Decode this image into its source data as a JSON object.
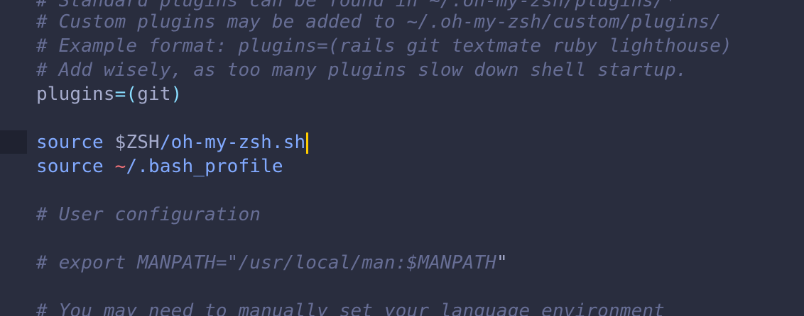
{
  "editor": {
    "lines": {
      "l0": "# Standard plugins can be found in ~/.oh-my-zsh/plugins/*",
      "l1": "# Custom plugins may be added to ~/.oh-my-zsh/custom/plugins/",
      "l2": "# Example format: plugins=(rails git textmate ruby lighthouse)",
      "l3": "# Add wisely, as too many plugins slow down shell startup.",
      "l4": {
        "name": "plugins",
        "op": "=(",
        "value": "git",
        "close": ")"
      },
      "l6": {
        "kw": "source",
        "sp": " ",
        "dollar": "$",
        "var": "ZSH",
        "path": "/oh-my-zsh.sh"
      },
      "l7": {
        "kw": "source",
        "sp": " ",
        "tilde": "~",
        "path": "/.bash_profile"
      },
      "l9": "# User configuration",
      "l11": {
        "comment": "# export MANPATH=\"/usr/local/man:$MANPATH",
        "quote": "\""
      },
      "l13": "# You may need to manually set your language environment"
    },
    "colors": {
      "background": "#292d3e",
      "comment": "#676e95",
      "keyword": "#82aaff",
      "operator": "#89ddff",
      "tilde": "#f07178",
      "cursor": "#ffcc00"
    }
  }
}
